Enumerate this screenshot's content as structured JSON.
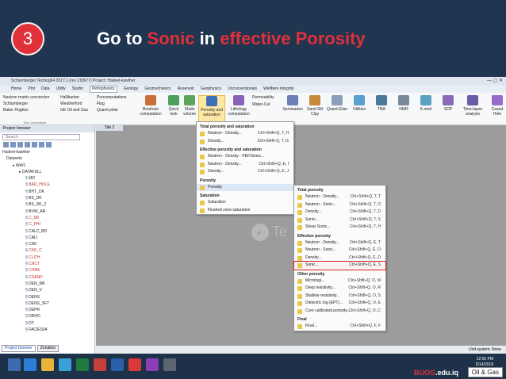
{
  "slide": {
    "step_number": "3",
    "title_part1": "Go to ",
    "title_part2": "Sonic",
    "title_part3": " in ",
    "title_part4": "effective Porosity"
  },
  "app": {
    "title": "Schlumberger Techlog64 2017.1 (rev 218677)    Project: Hadeel-kawther",
    "menus": [
      "Home",
      "Plot",
      "Data",
      "Utility",
      "Studio",
      "Petrophysics",
      "Geology",
      "Geomechanics",
      "Reservoir",
      "Geophysics",
      "Unconventionals",
      "Wellbore integrity"
    ],
    "ribbon": {
      "left_items": [
        "Neutron matrix conversion",
        "Schlumberger",
        "Baker Hughes"
      ],
      "left_items2": [
        "Halliburton",
        "Weatherford",
        "GE Oil and Gas"
      ],
      "mid_items": [
        "Precomputations",
        "Flag",
        "Quanti plots"
      ],
      "group_footer": "Env. corrections",
      "buttons": [
        {
          "label": "Borehole computation"
        },
        {
          "label": "Quick look"
        },
        {
          "label": "Shale volume"
        },
        {
          "label": "Porosity and saturation"
        },
        {
          "label": "Lithology computation"
        }
      ],
      "perm_items": [
        "Permeability",
        "Water-Cut"
      ],
      "right_buttons": [
        "Summaries",
        "Sand Silt Clay",
        "Quanti.Elan",
        "Utilities",
        "TBA",
        "NMR",
        "K.mod",
        "SDP",
        "Time-lapse analysis",
        "Cased Hole"
      ]
    },
    "browser": {
      "title": "Project browser",
      "search_placeholder": "Search",
      "tree": [
        {
          "text": "Hadeel-kawther",
          "lvl": 0,
          "red": false
        },
        {
          "text": "Datasets",
          "lvl": 1,
          "red": false
        },
        {
          "text": "Well1",
          "lvl": 2,
          "red": false
        },
        {
          "text": "DATAFULL",
          "lvl": 3,
          "red": false
        },
        {
          "text": "MD",
          "lvl": 4,
          "red": false
        },
        {
          "text": "BAD_HOLE",
          "lvl": 4,
          "red": true
        },
        {
          "text": "BHT_DK",
          "lvl": 4,
          "red": false
        },
        {
          "text": "BS_DK",
          "lvl": 4,
          "red": false
        },
        {
          "text": "BS_DK_2",
          "lvl": 4,
          "red": false
        },
        {
          "text": "BVW_AR",
          "lvl": 4,
          "red": false
        },
        {
          "text": "C_DK",
          "lvl": 4,
          "red": true
        },
        {
          "text": "C_PHI",
          "lvl": 4,
          "red": true
        },
        {
          "text": "CALC_BD",
          "lvl": 4,
          "red": false
        },
        {
          "text": "CALI",
          "lvl": 4,
          "red": false
        },
        {
          "text": "CKK",
          "lvl": 4,
          "red": false
        },
        {
          "text": "CKK_C",
          "lvl": 4,
          "red": true
        },
        {
          "text": "CLITH",
          "lvl": 4,
          "red": true
        },
        {
          "text": "CNCT",
          "lvl": 4,
          "red": true
        },
        {
          "text": "CORE",
          "lvl": 4,
          "red": true
        },
        {
          "text": "CSAND",
          "lvl": 4,
          "red": true
        },
        {
          "text": "DEN_BR",
          "lvl": 4,
          "red": false
        },
        {
          "text": "DEN_V",
          "lvl": 4,
          "red": false
        },
        {
          "text": "DENS",
          "lvl": 4,
          "red": false
        },
        {
          "text": "DENS_SFT",
          "lvl": 4,
          "red": false
        },
        {
          "text": "DEPR",
          "lvl": 4,
          "red": false
        },
        {
          "text": "DRHO",
          "lvl": 4,
          "red": false
        },
        {
          "text": "DT",
          "lvl": 4,
          "red": false
        },
        {
          "text": "FACIES04",
          "lvl": 4,
          "red": false
        }
      ],
      "tab_browser": "Project browser",
      "tab_zonation": "Zonation"
    },
    "workspace_tab": "Tab 2",
    "watermark": "Te",
    "status": "Unit system: None",
    "menu1": {
      "sections": [
        {
          "title": "Total porosity and saturation",
          "items": [
            {
              "label": "Neutron - Density...",
              "sc": "Ctrl+Shift+Q, T, H"
            },
            {
              "label": "Density...",
              "sc": "Ctrl+Shift+Q, T, G"
            }
          ]
        },
        {
          "title": "Effective porosity and saturation",
          "items": [
            {
              "label": "Neutron - Density - PEF/Sonic...",
              "sc": ""
            },
            {
              "label": "Neutron - Density...",
              "sc": "Ctrl+Shift+Q, E, I"
            },
            {
              "label": "Density...",
              "sc": "Ctrl+Shift+Q, E, J"
            }
          ]
        },
        {
          "title": "Porosity",
          "items": [
            {
              "label": "Porosity",
              "sc": ""
            }
          ]
        },
        {
          "title": "Saturation",
          "items": [
            {
              "label": "Saturation",
              "sc": ""
            },
            {
              "label": "Flushed zone saturation",
              "sc": ""
            }
          ]
        }
      ]
    },
    "menu2": {
      "sections": [
        {
          "title": "Total porosity",
          "items": [
            {
              "label": "Neutron - Density...",
              "sc": "Ctrl+Shift+Q, T, T"
            },
            {
              "label": "Neutron - Sonic...",
              "sc": "Ctrl+Shift+Q, T, O"
            },
            {
              "label": "Density...",
              "sc": "Ctrl+Shift+Q, T, D"
            },
            {
              "label": "Sonic...",
              "sc": "Ctrl+Shift+Q, T, S"
            },
            {
              "label": "Shear Sonic...",
              "sc": "Ctrl+Shift+Q, T, H"
            }
          ]
        },
        {
          "title": "Effective porosity",
          "items": [
            {
              "label": "Neutron - Density...",
              "sc": "Ctrl+Shift+Q, E, T"
            },
            {
              "label": "Neutron - Sonic...",
              "sc": "Ctrl+Shift+Q, E, O"
            },
            {
              "label": "Density...",
              "sc": "Ctrl+Shift+Q, E, D"
            },
            {
              "label": "Sonic...",
              "sc": "Ctrl+Shift+Q, E, S"
            }
          ]
        },
        {
          "title": "Other porosity",
          "items": [
            {
              "label": "Micrologi...",
              "sc": "Ctrl+Shift+Q, O, M"
            },
            {
              "label": "Deep resistivity...",
              "sc": "Ctrl+Shift+Q, O, R"
            },
            {
              "label": "Shallow resistivity...",
              "sc": "Ctrl+Shift+Q, O, S"
            },
            {
              "label": "Dielectric log (EPT)...",
              "sc": "Ctrl+Shift+Q, O, E"
            },
            {
              "label": "Core calibrated porosity...",
              "sc": "Ctrl+Shift+Q, O, C"
            }
          ]
        },
        {
          "title": "Final",
          "items": [
            {
              "label": "Final...",
              "sc": "Ctrl+Shift+Q, F, F"
            }
          ]
        }
      ]
    }
  },
  "taskbar": {
    "time": "12:55 PM",
    "date": "5/14/2018"
  },
  "branding": {
    "site_red": "BUOG",
    "site_rest": ".edu.iq",
    "label": "Oil & Gas"
  }
}
